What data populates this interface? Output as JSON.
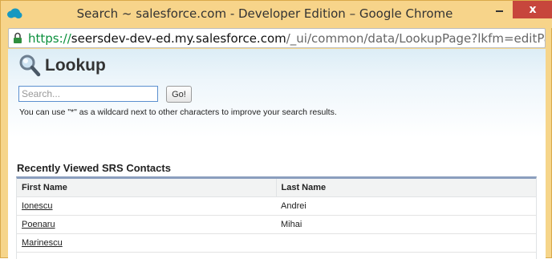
{
  "window": {
    "title": "Search ~ salesforce.com - Developer Edition – Google Chrome",
    "close_label": "x"
  },
  "address_bar": {
    "scheme": "https://",
    "host": "seersdev-dev-ed.my.salesforce.com",
    "path": "/_ui/common/data/LookupPage?lkfm=editPa"
  },
  "lookup": {
    "title": "Lookup",
    "search": {
      "placeholder": "Search...",
      "value": ""
    },
    "go_label": "Go!",
    "hint": "You can use \"*\" as a wildcard next to other characters to improve your search results."
  },
  "recent": {
    "title": "Recently Viewed SRS Contacts",
    "columns": [
      "First Name",
      "Last Name"
    ],
    "rows": [
      {
        "first": "Ionescu",
        "last": "Andrei"
      },
      {
        "first": "Poenaru",
        "last": "Mihai"
      },
      {
        "first": "Marinescu",
        "last": ""
      }
    ]
  },
  "colors": {
    "title_bar": "#f7d48a",
    "close_button": "#c7463c",
    "secure_scheme": "#0a8f3c",
    "table_top_border": "#8a9ebe"
  },
  "icons": {
    "app": "salesforce-cloud-icon",
    "lock": "lock-icon",
    "lookup": "magnifier-icon"
  }
}
